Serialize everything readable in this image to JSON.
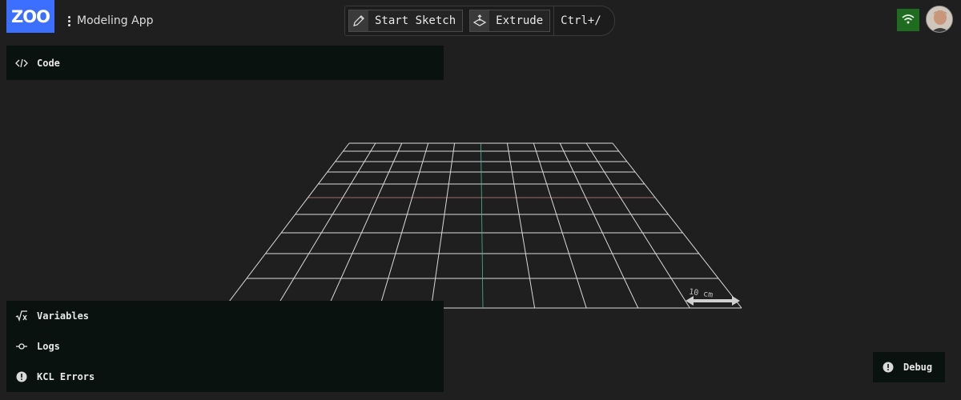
{
  "header": {
    "logo_text": "ZOO",
    "app_name": "Modeling App",
    "menu_icon": "kebab-menu-icon"
  },
  "toolbar": {
    "start_sketch_label": "Start Sketch",
    "start_sketch_icon": "pencil-sketch-icon",
    "extrude_label": "Extrude",
    "extrude_icon": "extrude-icon",
    "command_shortcut": "Ctrl+/"
  },
  "status": {
    "network_icon": "wifi-icon",
    "network_color": "#1f6b1f",
    "avatar_icon": "user-avatar"
  },
  "panes": {
    "code_label": "Code",
    "code_icon": "code-brackets-icon",
    "variables_label": "Variables",
    "variables_icon": "sqrt-x-icon",
    "logs_label": "Logs",
    "logs_icon": "commit-node-icon",
    "kcl_errors_label": "KCL Errors",
    "kcl_errors_icon": "exclamation-circle-icon"
  },
  "debug": {
    "label": "Debug",
    "icon": "exclamation-circle-icon"
  },
  "viewport": {
    "scale_label": "10 cm",
    "grid_color": "#d9d9d9",
    "x_axis_color": "#c98a8a",
    "y_axis_color": "#4fb39a"
  },
  "colors": {
    "brand": "#3d6fff",
    "panel_bg": "#0a120f",
    "app_bg": "#1f1f1f"
  }
}
